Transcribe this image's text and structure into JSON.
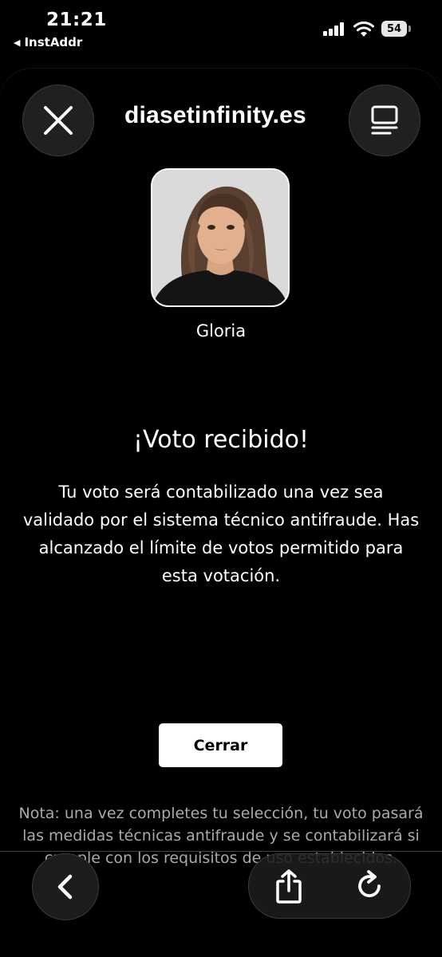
{
  "status_bar": {
    "time": "21:21",
    "back_app_label": "InstAddr",
    "battery_level": "54",
    "icons": [
      "cellular-signal-icon",
      "wifi-icon",
      "battery-icon"
    ]
  },
  "browser": {
    "url_display": "diasetinfinity.es",
    "close_icon": "close-icon",
    "menu_icon": "menu-icon"
  },
  "contestant": {
    "name": "Gloria",
    "photo": "contestant-photo"
  },
  "confirmation": {
    "title": "¡Voto recibido!",
    "message": "Tu voto será contabilizado una vez sea validado por el sistema técnico antifraude. Has alcanzado el límite de votos permitido para esta votación.",
    "close_button_label": "Cerrar"
  },
  "note": {
    "text": "Nota: una vez completes tu selección, tu voto pasará las medidas técnicas antifraude y se contabilizará si cumple con los requisitos de uso establecidos."
  },
  "bottom_toolbar": {
    "icons": [
      "back-chevron-icon",
      "share-icon",
      "reload-icon"
    ]
  },
  "colors": {
    "background": "#000000",
    "button": "#ffffff",
    "note_text": "#aaaaaa"
  }
}
